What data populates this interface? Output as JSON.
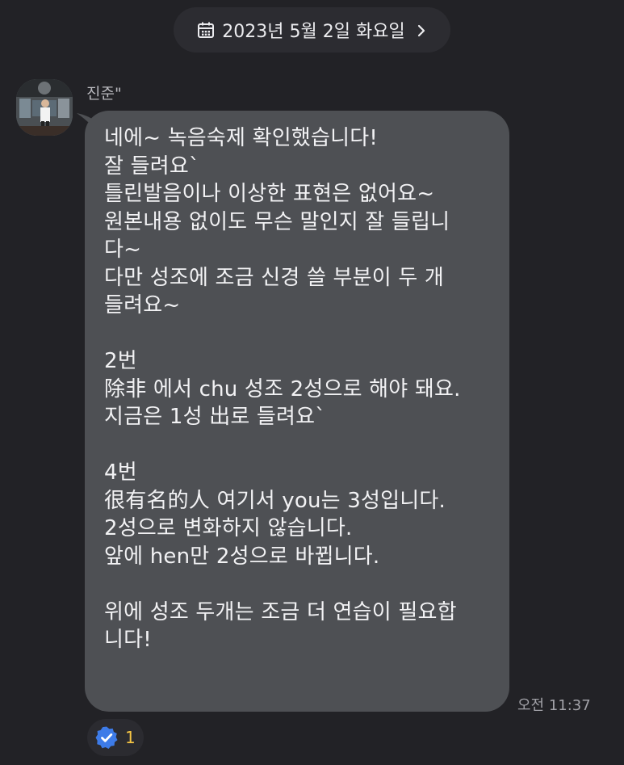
{
  "date_header": {
    "label": "2023년 5월 2일 화요일",
    "icon": "calendar-icon",
    "chevron_icon": "chevron-right-icon"
  },
  "message": {
    "sender": "진준\"",
    "text": "네에~ 녹음숙제 확인했습니다!\n잘 들려요`\n틀린발음이나 이상한 표현은 없어요~\n원본내용 없이도 무슨 말인지 잘 들립니\n다~\n다만 성조에 조금 신경 쓸 부분이 두 개\n들려요~\n\n2번\n除非 에서 chu 성조 2성으로 해야 돼요.\n지금은 1성 出로 들려요`\n\n4번\n很有名的人 여기서 you는 3성입니다.\n2성으로 변화하지 않습니다.\n앞에 hen만 2성으로 바뀝니다.\n\n위에 성조 두개는 조금 더 연습이 필요합\n니다!",
    "time": "오전 11:37"
  },
  "reaction": {
    "icon": "check-badge-icon",
    "count": "1",
    "colors": {
      "badge": "#3d7be8",
      "count": "#f6c544"
    }
  },
  "colors": {
    "background": "#222226",
    "bubble": "#4e5054",
    "pill": "#2c2c31"
  }
}
